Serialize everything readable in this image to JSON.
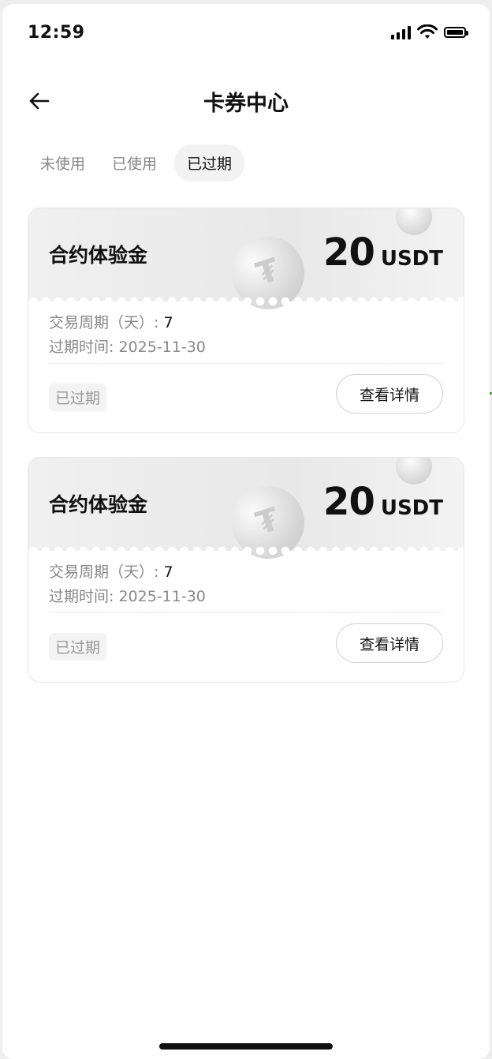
{
  "status_bar": {
    "time": "12:59"
  },
  "header": {
    "title": "卡券中心",
    "back_icon": "arrow-left-icon"
  },
  "tabs": [
    {
      "label": "未使用",
      "active": false
    },
    {
      "label": "已使用",
      "active": false
    },
    {
      "label": "已过期",
      "active": true
    }
  ],
  "cards": [
    {
      "name": "合约体验金",
      "amount": "20",
      "unit": "USDT",
      "period_label": "交易周期（天）:",
      "period_value": "7",
      "expire_label": "过期时间:",
      "expire_value": "2025-11-30",
      "status": "已过期",
      "button": "查看详情"
    },
    {
      "name": "合约体验金",
      "amount": "20",
      "unit": "USDT",
      "period_label": "交易周期（天）:",
      "period_value": "7",
      "expire_label": "过期时间:",
      "expire_value": "2025-11-30",
      "status": "已过期",
      "button": "查看详情"
    }
  ],
  "colors": {
    "highlight": "#f04a4a",
    "connector": "#41a62a"
  }
}
